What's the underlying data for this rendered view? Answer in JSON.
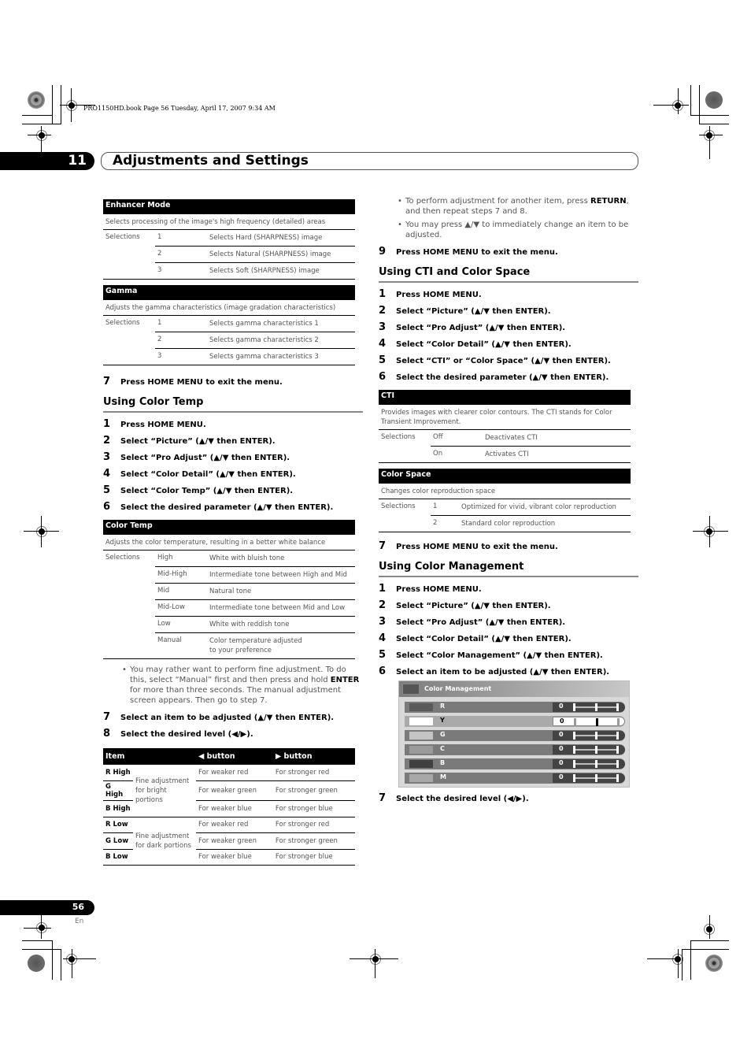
{
  "print_info": "PRO1150HD.book  Page 56  Tuesday, April 17, 2007  9:34 AM",
  "header": {
    "chapter_number": "11",
    "chapter_title": "Adjustments and Settings"
  },
  "footer": {
    "page_number": "56",
    "language": "En"
  },
  "left": {
    "enhancer": {
      "title": "Enhancer Mode",
      "description": "Selects processing of the image's high frequency (detailed) areas",
      "label": "Selections",
      "rows": [
        {
          "value": "1",
          "text": "Selects Hard (SHARPNESS) image"
        },
        {
          "value": "2",
          "text": "Selects Natural (SHARPNESS) image"
        },
        {
          "value": "3",
          "text": "Selects Soft (SHARPNESS) image"
        }
      ]
    },
    "gamma": {
      "title": "Gamma",
      "description": "Adjusts the gamma characteristics (image gradation characteristics)",
      "label": "Selections",
      "rows": [
        {
          "value": "1",
          "text": "Selects gamma characteristics 1"
        },
        {
          "value": "2",
          "text": "Selects gamma characteristics 2"
        },
        {
          "value": "3",
          "text": "Selects gamma characteristics 3"
        }
      ]
    },
    "step7": {
      "num": "7",
      "text": "Press HOME MENU to exit the menu."
    },
    "color_temp_section": {
      "title": "Using Color Temp",
      "steps": [
        {
          "num": "1",
          "text": "Press HOME MENU."
        },
        {
          "num": "2",
          "text": "Select “Picture” (▲/▼ then ENTER)."
        },
        {
          "num": "3",
          "text": "Select “Pro Adjust” (▲/▼ then ENTER)."
        },
        {
          "num": "4",
          "text": "Select “Color Detail” (▲/▼ then ENTER)."
        },
        {
          "num": "5",
          "text": "Select “Color Temp” (▲/▼ then ENTER)."
        },
        {
          "num": "6",
          "text": "Select the desired parameter (▲/▼ then ENTER)."
        }
      ]
    },
    "color_temp_table": {
      "title": "Color Temp",
      "description": "Adjusts the color temperature, resulting in a better white balance",
      "label": "Selections",
      "rows": [
        {
          "value": "High",
          "text": "White with bluish tone"
        },
        {
          "value": "Mid-High",
          "text": "Intermediate tone between High and Mid"
        },
        {
          "value": "Mid",
          "text": "Natural tone"
        },
        {
          "value": "Mid-Low",
          "text": "Intermediate tone between Mid and Low"
        },
        {
          "value": "Low",
          "text": "White with reddish tone"
        },
        {
          "value": "Manual",
          "text": "Color temperature adjusted to your preference"
        }
      ]
    },
    "note": {
      "pre": "You may rather want to perform fine adjustment. To do this, select “Manual” first and then press and hold ",
      "bold": "ENTER",
      "post": " for more than three seconds. The manual adjustment screen appears. Then go to step 7."
    },
    "steps_after": [
      {
        "num": "7",
        "text": "Select an item to be adjusted (▲/▼ then ENTER)."
      },
      {
        "num": "8",
        "text": "Select the desired level (◀/▶)."
      }
    ],
    "item_table": {
      "headers": [
        "Item",
        "◀ button",
        "▶ button"
      ],
      "groups": [
        {
          "description": "Fine adjustment for bright portions",
          "rows": [
            {
              "item": "R High",
              "left": "For weaker red",
              "right": "For stronger red"
            },
            {
              "item": "G High",
              "left": "For weaker green",
              "right": "For stronger green"
            },
            {
              "item": "B High",
              "left": "For weaker blue",
              "right": "For stronger blue"
            }
          ]
        },
        {
          "description": "Fine adjustment for dark portions",
          "rows": [
            {
              "item": "R Low",
              "left": "For weaker red",
              "right": "For stronger red"
            },
            {
              "item": "G Low",
              "left": "For weaker green",
              "right": "For stronger green"
            },
            {
              "item": "B Low",
              "left": "For weaker blue",
              "right": "For stronger blue"
            }
          ]
        }
      ]
    }
  },
  "right": {
    "bullets": [
      {
        "pre": "To perform adjustment for another item, press ",
        "bold": "RETURN",
        "post": ", and then repeat steps 7 and 8."
      },
      {
        "pre": "You may press ▲/▼ to immediately change an item to be adjusted.",
        "bold": "",
        "post": ""
      }
    ],
    "step9": {
      "num": "9",
      "text": "Press HOME MENU to exit the menu."
    },
    "cti_section": {
      "title": "Using CTI and Color Space",
      "steps": [
        {
          "num": "1",
          "text": "Press HOME MENU."
        },
        {
          "num": "2",
          "text": "Select “Picture” (▲/▼ then ENTER)."
        },
        {
          "num": "3",
          "text": "Select “Pro Adjust” (▲/▼ then ENTER)."
        },
        {
          "num": "4",
          "text": "Select “Color Detail” (▲/▼ then ENTER)."
        },
        {
          "num": "5",
          "text": "Select “CTI” or “Color Space” (▲/▼ then ENTER)."
        },
        {
          "num": "6",
          "text": "Select the desired parameter (▲/▼ then ENTER)."
        }
      ]
    },
    "cti_table": {
      "title": "CTI",
      "description": "Provides images with clearer color contours. The CTI stands for Color Transient Improvement.",
      "label": "Selections",
      "rows": [
        {
          "value": "Off",
          "text": "Deactivates CTI"
        },
        {
          "value": "On",
          "text": "Activates CTI"
        }
      ]
    },
    "color_space_table": {
      "title": "Color Space",
      "description": "Changes color reproduction space",
      "label": "Selections",
      "rows": [
        {
          "value": "1",
          "text": "Optimized for vivid, vibrant color reproduction"
        },
        {
          "value": "2",
          "text": "Standard color reproduction"
        }
      ]
    },
    "step7": {
      "num": "7",
      "text": "Press HOME MENU to exit the menu."
    },
    "cm_section": {
      "title": "Using Color Management",
      "steps": [
        {
          "num": "1",
          "text": "Press HOME MENU."
        },
        {
          "num": "2",
          "text": "Select “Picture” (▲/▼ then ENTER)."
        },
        {
          "num": "3",
          "text": "Select “Pro Adjust” (▲/▼ then ENTER)."
        },
        {
          "num": "4",
          "text": "Select “Color Detail” (▲/▼ then ENTER)."
        },
        {
          "num": "5",
          "text": "Select “Color Management” (▲/▼ then ENTER)."
        },
        {
          "num": "6",
          "text": "Select an item to be adjusted (▲/▼ then ENTER)."
        }
      ]
    },
    "osd": {
      "title": "Color Management",
      "rows": [
        {
          "label": "R",
          "value": "0",
          "swatch": "#5a5a5a",
          "selected": false
        },
        {
          "label": "Y",
          "value": "0",
          "swatch": "#ffffff",
          "selected": true
        },
        {
          "label": "G",
          "value": "0",
          "swatch": "#c4c4c4",
          "selected": false
        },
        {
          "label": "C",
          "value": "0",
          "swatch": "#9a9a9a",
          "selected": false
        },
        {
          "label": "B",
          "value": "0",
          "swatch": "#3f3f3f",
          "selected": false
        },
        {
          "label": "M",
          "value": "0",
          "swatch": "#a8a8a8",
          "selected": false
        }
      ]
    },
    "final_step": {
      "num": "7",
      "text": "Select the desired level (◀/▶)."
    }
  }
}
